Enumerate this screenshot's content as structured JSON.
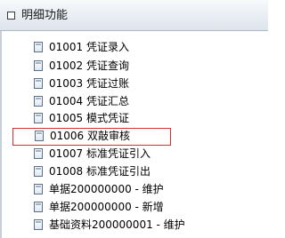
{
  "panel": {
    "title": "明细功能"
  },
  "tree": {
    "items": [
      {
        "label": "01001  凭证录入",
        "selected": false
      },
      {
        "label": "01002  凭证查询",
        "selected": false
      },
      {
        "label": "01003  凭证过账",
        "selected": false
      },
      {
        "label": "01004  凭证汇总",
        "selected": false
      },
      {
        "label": "01005  模式凭证",
        "selected": false
      },
      {
        "label": "01006  双敲审核",
        "selected": true
      },
      {
        "label": "01007  标准凭证引入",
        "selected": false
      },
      {
        "label": "01008  标准凭证引出",
        "selected": false
      },
      {
        "label": "单据200000000 - 维护",
        "selected": false
      },
      {
        "label": "单据200000000 - 新增",
        "selected": false
      },
      {
        "label": "基础资料200000001 - 维护",
        "selected": false
      }
    ]
  }
}
